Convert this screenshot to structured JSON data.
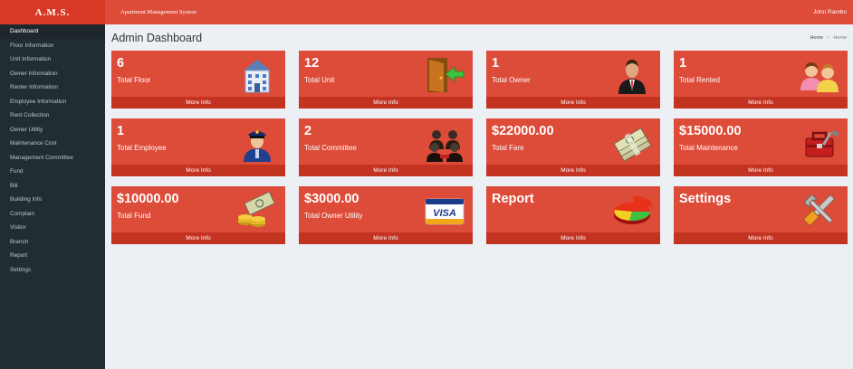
{
  "app": {
    "brand": "A.M.S.",
    "system_name": "Apartment Management System",
    "user": "John Rambo"
  },
  "sidebar": {
    "items": [
      {
        "label": "Dashboard"
      },
      {
        "label": "Floor Information"
      },
      {
        "label": "Unit Information"
      },
      {
        "label": "Owner Information"
      },
      {
        "label": "Renter Information"
      },
      {
        "label": "Employee Information"
      },
      {
        "label": "Rent Collection"
      },
      {
        "label": "Owner Utility"
      },
      {
        "label": "Maintenance Cost"
      },
      {
        "label": "Management Committee"
      },
      {
        "label": "Fund"
      },
      {
        "label": "Bill"
      },
      {
        "label": "Building Info"
      },
      {
        "label": "Complain"
      },
      {
        "label": "Visitor"
      },
      {
        "label": "Branch"
      },
      {
        "label": "Report"
      },
      {
        "label": "Settings"
      }
    ]
  },
  "page": {
    "title": "Admin Dashboard",
    "breadcrumb": [
      "Home",
      ">",
      "Home"
    ]
  },
  "tiles": [
    {
      "value": "6",
      "label": "Total Floor",
      "more": "More Info",
      "icon": "building-icon"
    },
    {
      "value": "12",
      "label": "Total Unit",
      "more": "More Info",
      "icon": "door-icon"
    },
    {
      "value": "1",
      "label": "Total Owner",
      "more": "More Info",
      "icon": "businessman-icon"
    },
    {
      "value": "1",
      "label": "Total Rented",
      "more": "More Info",
      "icon": "users-icon"
    },
    {
      "value": "1",
      "label": "Total Employee",
      "more": "More Info",
      "icon": "police-officer-icon"
    },
    {
      "value": "2",
      "label": "Total Committee",
      "more": "More Info",
      "icon": "meeting-icon"
    },
    {
      "value": "$22000.00",
      "label": "Total Fare",
      "more": "More Info",
      "icon": "money-stack-icon"
    },
    {
      "value": "$15000.00",
      "label": "Total Maintenance",
      "more": "More Info",
      "icon": "toolbox-icon"
    },
    {
      "value": "$10000.00",
      "label": "Total Fund",
      "more": "More Info",
      "icon": "coins-cash-icon"
    },
    {
      "value": "$3000.00",
      "label": "Total Owner Utility",
      "more": "More Info",
      "icon": "visa-card-icon"
    },
    {
      "value": "Report",
      "label": "",
      "more": "More Info",
      "icon": "pie-chart-icon"
    },
    {
      "value": "Settings",
      "label": "",
      "more": "More Info",
      "icon": "tools-icon"
    }
  ],
  "colors": {
    "brand_red": "#dd4b39",
    "brand_dark_red": "#d73925",
    "sidebar_bg": "#222d32",
    "content_bg": "#ecf0f5"
  }
}
